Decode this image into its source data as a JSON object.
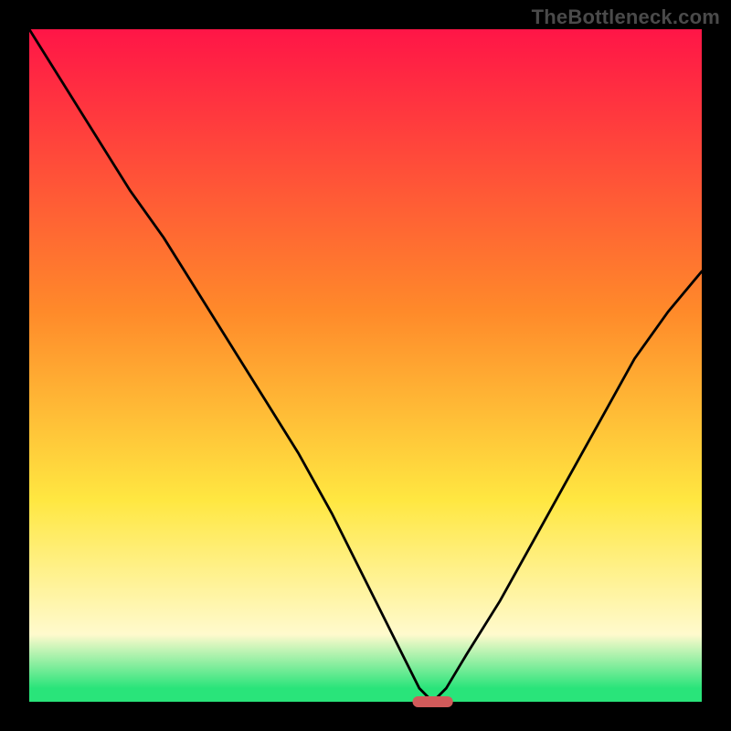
{
  "watermark": "TheBottleneck.com",
  "colors": {
    "top": "#ff1547",
    "orange": "#ff8a2a",
    "yellow": "#ffe741",
    "paleyellow": "#fffacd",
    "green": "#29e47a",
    "marker": "#d15a5a",
    "curve": "#000000",
    "frame": "#000000"
  },
  "chart_data": {
    "type": "line",
    "title": "",
    "xlabel": "",
    "ylabel": "",
    "xlim": [
      0,
      100
    ],
    "ylim": [
      0,
      100
    ],
    "x": [
      0,
      5,
      10,
      15,
      20,
      25,
      30,
      35,
      40,
      45,
      50,
      55,
      58,
      60,
      62,
      65,
      70,
      75,
      80,
      85,
      90,
      95,
      100
    ],
    "values": [
      100,
      92,
      84,
      76,
      69,
      61,
      53,
      45,
      37,
      28,
      18,
      8,
      2,
      0,
      2,
      7,
      15,
      24,
      33,
      42,
      51,
      58,
      64
    ],
    "marker": {
      "x_center": 60,
      "x_halfwidth": 3,
      "y": 0
    },
    "annotations": []
  }
}
